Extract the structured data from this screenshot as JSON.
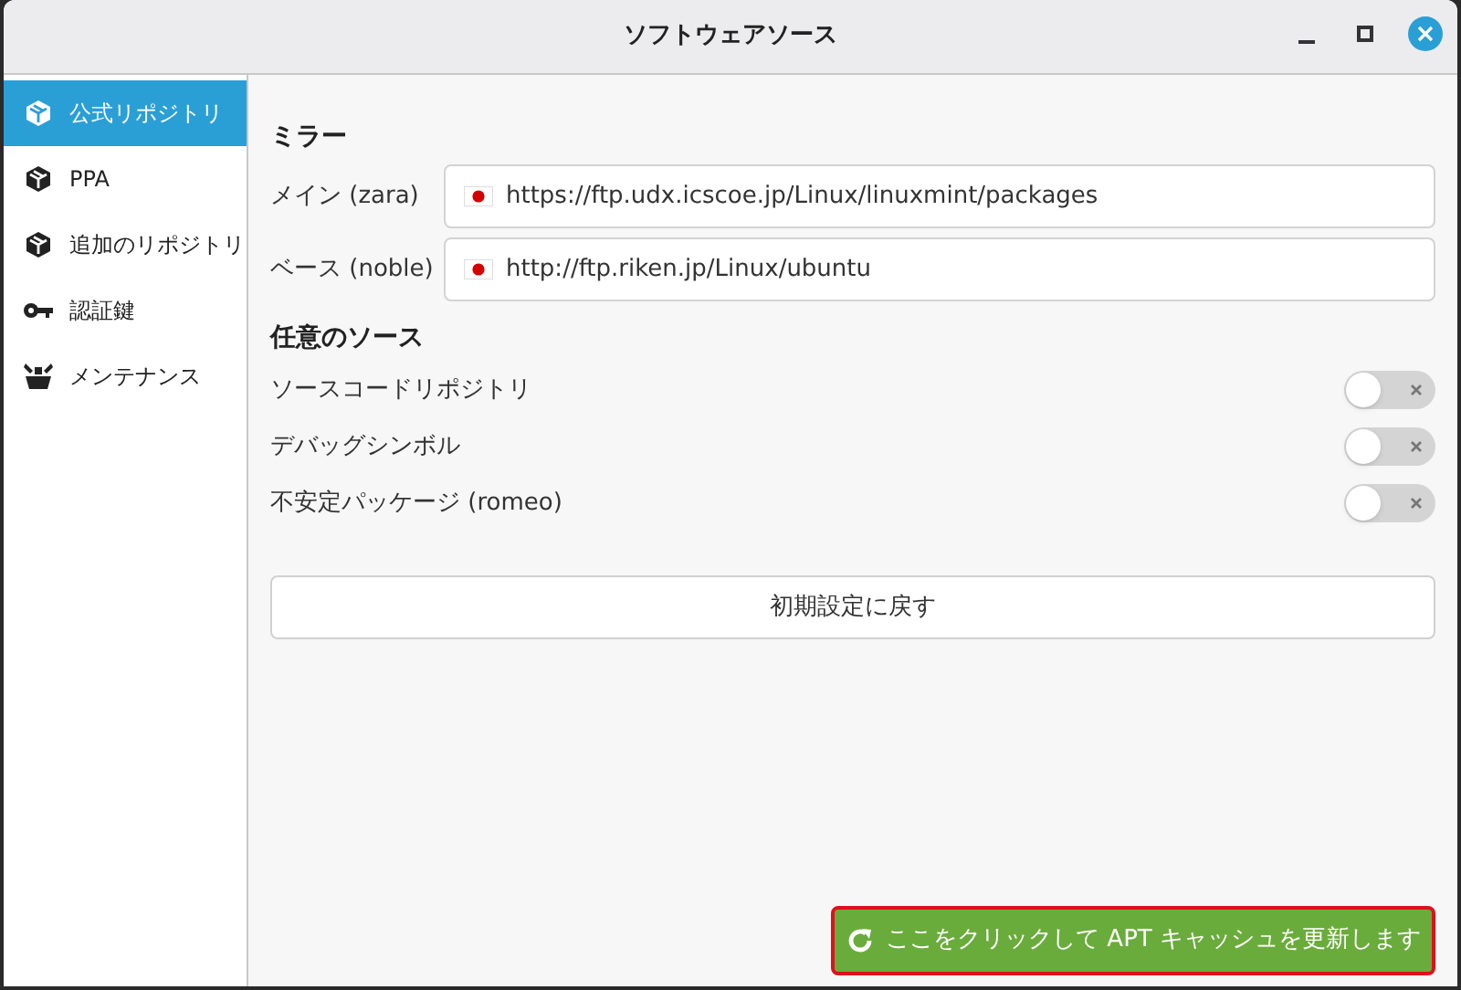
{
  "window": {
    "title": "ソフトウェアソース"
  },
  "sidebar": {
    "items": [
      {
        "label": "公式リポジトリ",
        "kind": "box",
        "selected": true
      },
      {
        "label": "PPA",
        "kind": "box",
        "selected": false
      },
      {
        "label": "追加のリポジトリ",
        "kind": "box",
        "selected": false
      },
      {
        "label": "認証鍵",
        "kind": "key",
        "selected": false
      },
      {
        "label": "メンテナンス",
        "kind": "tools",
        "selected": false
      }
    ]
  },
  "mirrors": {
    "heading": "ミラー",
    "items": [
      {
        "label": "メイン (zara)",
        "url": "https://ftp.udx.icscoe.jp/Linux/linuxmint/packages"
      },
      {
        "label": "ベース (noble)",
        "url": "http://ftp.riken.jp/Linux/ubuntu"
      }
    ]
  },
  "optional": {
    "heading": "任意のソース",
    "items": [
      {
        "label": "ソースコードリポジトリ",
        "on": false
      },
      {
        "label": "デバッグシンボル",
        "on": false
      },
      {
        "label": "不安定パッケージ (romeo)",
        "on": false
      }
    ]
  },
  "reset_button": "初期設定に戻す",
  "update_button": {
    "label": "ここをクリックして APT キャッシュを更新します",
    "highlighted": true
  }
}
